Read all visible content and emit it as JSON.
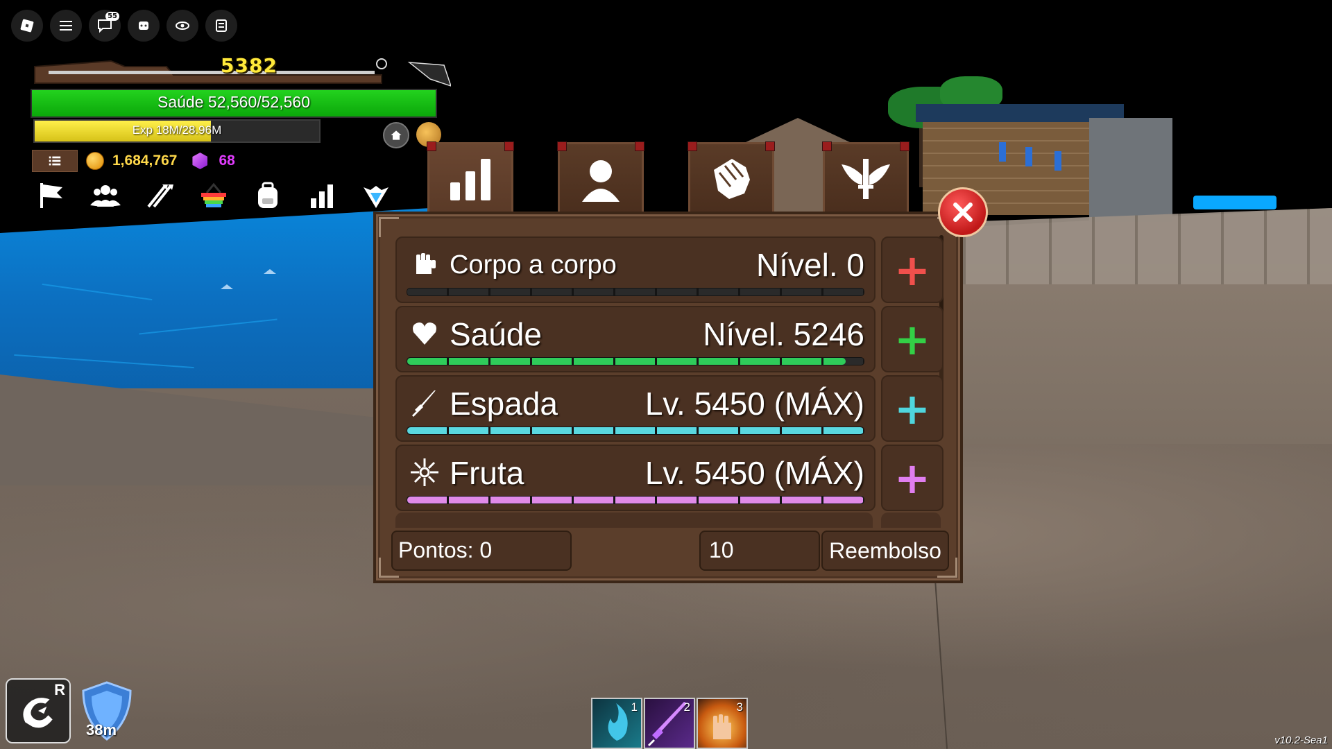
{
  "topbar": {
    "chat_badge": "55",
    "buttons": [
      "roblox-logo-icon",
      "hamburger-menu-icon",
      "chat-icon",
      "avatar-icon",
      "eye-icon",
      "inventory-icon"
    ]
  },
  "hud": {
    "player_level": "5382",
    "health_text": "Saúde 52,560/52,560",
    "health_fraction": 1.0,
    "exp_text": "Exp 18M/28.96M",
    "exp_fraction": 0.62,
    "money": "1,684,767",
    "gems": "68",
    "menu_icons": [
      "flag-icon",
      "crew-icon",
      "arrows-icon",
      "shop-basket-icon",
      "backpack-icon",
      "stats-bars-icon",
      "emblem-icon"
    ]
  },
  "tabs": [
    {
      "name": "stats-tab",
      "icon": "bar-chart-icon"
    },
    {
      "name": "profile-tab",
      "icon": "person-icon"
    },
    {
      "name": "fighting-style-tab",
      "icon": "fist-icon"
    },
    {
      "name": "titles-tab",
      "icon": "sword-wings-icon"
    }
  ],
  "stats": {
    "rows": [
      {
        "name": "Corpo a corpo",
        "level": "Nível. 0",
        "icon": "fist-icon",
        "plus_color": "#f0504c",
        "bar_color": "#2f2f2f",
        "fill": 0.0
      },
      {
        "name": "Saúde",
        "level": "Nível. 5246",
        "icon": "heart-icon",
        "plus_color": "#33d046",
        "bar_color": "#2fcc5a",
        "fill": 0.96
      },
      {
        "name": "Espada",
        "level": "Lv. 5450 (MÁX)",
        "icon": "sword-icon",
        "plus_color": "#4fd6de",
        "bar_color": "#5ad8e0",
        "fill": 1.0
      },
      {
        "name": "Fruta",
        "level": "Lv. 5450 (MÁX)",
        "icon": "fruit-spark-icon",
        "plus_color": "#e07ef0",
        "bar_color": "#e08ae8",
        "fill": 1.0
      }
    ],
    "plus_symbol": "+",
    "points_label": "Pontos: 0",
    "quantity": "10",
    "refund_label": "Reembolso"
  },
  "bottom": {
    "dragon_key": "R",
    "shield_timer": "38m",
    "hotbar": [
      {
        "num": "1",
        "icon": "blue-flame-icon"
      },
      {
        "num": "2",
        "icon": "purple-sword-icon"
      },
      {
        "num": "3",
        "icon": "fire-fist-icon"
      }
    ],
    "version": "v10.2-Sea1"
  }
}
